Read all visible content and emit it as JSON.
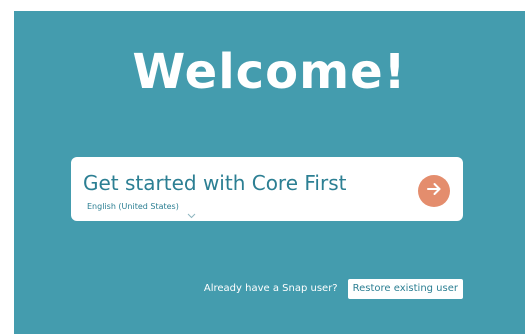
{
  "colors": {
    "background": "#449cae",
    "card": "#ffffff",
    "accent_text": "#2c7f93",
    "go_button": "#e48d6d"
  },
  "heading": {
    "title": "Welcome!"
  },
  "start_card": {
    "title": "Get started with Core First",
    "language": "English (United States)",
    "language_icon": "chevron-down-icon",
    "go_icon": "arrow-right-icon"
  },
  "footer": {
    "prompt": "Already have a Snap user?",
    "restore_label": "Restore existing user"
  }
}
